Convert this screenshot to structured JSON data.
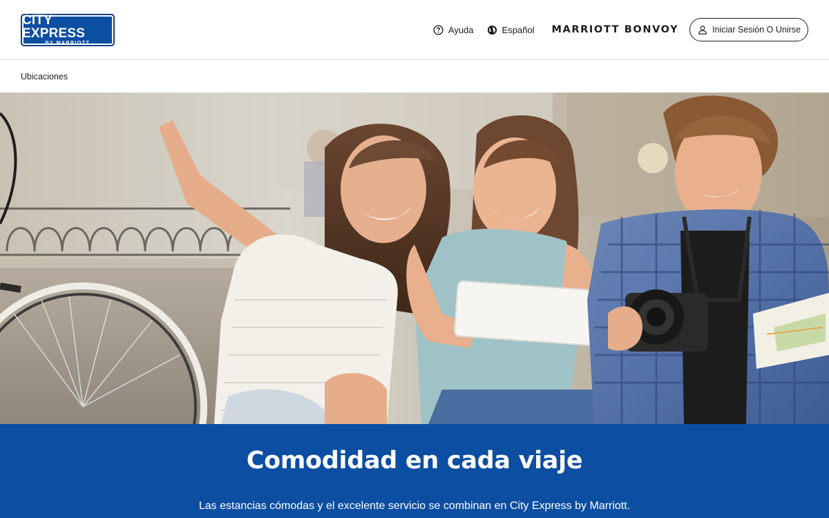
{
  "header": {
    "logo": {
      "main": "CITY EXPRESS",
      "sub": "BY MARRIOTT"
    },
    "help_label": "Ayuda",
    "language_label": "Español",
    "bonvoy_logo": "MARRIOTT BONVOY",
    "signin_label": "Iniciar Sesión O Unirse"
  },
  "subnav": {
    "locations_label": "Ubicaciones"
  },
  "hero": {
    "banner_title": "Comodidad en cada viaje",
    "banner_text": "Las estancias cómodas y el excelente servicio se combinan en City Express by Marriott."
  },
  "icons": {
    "help": "help-circle-icon",
    "language": "globe-icon",
    "user": "user-icon"
  },
  "colors": {
    "brand_blue": "#0c4ea2",
    "text": "#1c1c1c",
    "white": "#ffffff"
  }
}
